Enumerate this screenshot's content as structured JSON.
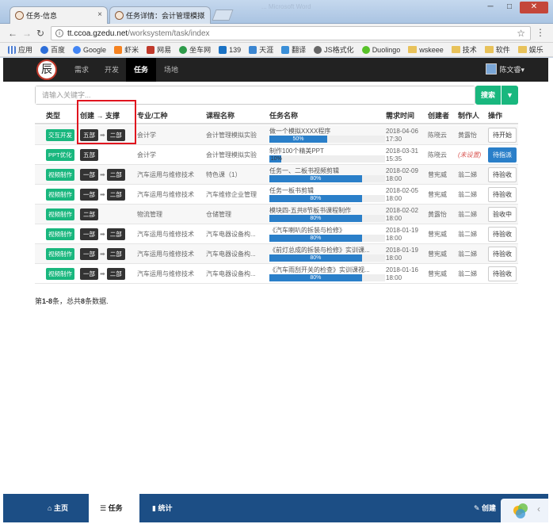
{
  "browser": {
    "tabs": [
      {
        "label": "任务-信息",
        "close": "×"
      },
      {
        "label": "任务详情：会计管理模拟",
        "close": "×"
      }
    ],
    "window_title": "... Microsoft Word",
    "controls": {
      "minimize": "─",
      "maximize": "□",
      "close": "✕"
    },
    "url_host": "tt.ccoa.gzedu.net",
    "url_path": "/worksystem/task/index",
    "bookmarks": [
      "应用",
      "百度",
      "Google",
      "虾米",
      "网易",
      "坐车网",
      "139",
      "天涯",
      "翻译",
      "JS格式化",
      "Duolingo",
      "wskeee",
      "技术",
      "软件",
      "娱乐"
    ]
  },
  "app": {
    "logo_char": "辰",
    "nav": [
      "需求",
      "开发",
      "任务",
      "场地"
    ],
    "active_nav": "任务",
    "user": "陈文睿▾",
    "search": {
      "placeholder": "请输入关键字...",
      "button": "搜索",
      "dropdown": "▼"
    }
  },
  "table": {
    "headers": [
      "类型",
      "创建 → 支撑",
      "专业/工种",
      "课程名称",
      "任务名称",
      "需求时间",
      "创建者",
      "制作人",
      "操作"
    ],
    "rows": [
      {
        "type": "交互开发",
        "dept_from": "五部",
        "dept_to": "二部",
        "major": "会计学",
        "course": "会计管理模拟实验",
        "task": "做一个模拟XXXX程序",
        "progress": 50,
        "progress_label": "50%",
        "date": "2018-04-06",
        "time": "17:30",
        "creator": "陈晓云",
        "maker": "黄露怡",
        "action": "待开始"
      },
      {
        "type": "PPT优化",
        "dept_from": "五部",
        "dept_to": "",
        "major": "会计学",
        "course": "会计管理模拟实验",
        "task": "制作100个精美PPT",
        "progress": 10,
        "progress_label": "10%",
        "date": "2018-03-31",
        "time": "15:35",
        "creator": "陈晓云",
        "maker": "(未设置)",
        "action": "待指派"
      },
      {
        "type": "视频制作",
        "dept_from": "一部",
        "dept_to": "二部",
        "major": "汽车运用与维修技术",
        "course": "特色课（1）",
        "task": "任务一、二板书视频剪辑",
        "progress": 80,
        "progress_label": "80%",
        "date": "2018-02-09",
        "time": "18:00",
        "creator": "曾宪威",
        "maker": "翁二娣",
        "action": "待验收"
      },
      {
        "type": "视频制作",
        "dept_from": "一部",
        "dept_to": "二部",
        "major": "汽车运用与维修技术",
        "course": "汽车维修企业管理",
        "task": "任务一板书剪辑",
        "progress": 80,
        "progress_label": "80%",
        "date": "2018-02-05",
        "time": "18:00",
        "creator": "曾宪威",
        "maker": "翁二娣",
        "action": "待验收"
      },
      {
        "type": "视频制作",
        "dept_from": "二部",
        "dept_to": "",
        "major": "物流管理",
        "course": "仓储管理",
        "task": "模块四-五共8节板书课程制作",
        "progress": 80,
        "progress_label": "80%",
        "date": "2018-02-02",
        "time": "18:00",
        "creator": "黄露怡",
        "maker": "翁二娣",
        "action": "验收中"
      },
      {
        "type": "视频制作",
        "dept_from": "一部",
        "dept_to": "二部",
        "major": "汽车运用与维修技术",
        "course": "汽车电器设备构...",
        "task": "《汽车喇叭的拆装与检修》",
        "progress": 80,
        "progress_label": "80%",
        "date": "2018-01-19",
        "time": "18:00",
        "creator": "曾宪威",
        "maker": "翁二娣",
        "action": "待验收"
      },
      {
        "type": "视频制作",
        "dept_from": "一部",
        "dept_to": "二部",
        "major": "汽车运用与维修技术",
        "course": "汽车电器设备构...",
        "task": "《前灯总成的拆装与检修》实训课...",
        "progress": 80,
        "progress_label": "80%",
        "date": "2018-01-19",
        "time": "18:00",
        "creator": "曾宪威",
        "maker": "翁二娣",
        "action": "待验收"
      },
      {
        "type": "视频制作",
        "dept_from": "一部",
        "dept_to": "二部",
        "major": "汽车运用与维修技术",
        "course": "汽车电器设备构...",
        "task": "《汽车雨刮开关的检查》实训课视...",
        "progress": 80,
        "progress_label": "80%",
        "date": "2018-01-16",
        "time": "18:00",
        "creator": "曾宪威",
        "maker": "翁二娣",
        "action": "待验收"
      }
    ],
    "arrow": "➡",
    "summary_prefix": "第",
    "summary_range": "1-8",
    "summary_mid": "条，总共",
    "summary_total": "8",
    "summary_suffix": "条数据."
  },
  "footer": {
    "home": "主页",
    "tasks": "任务",
    "stats": "统计",
    "create": "创建",
    "back": "‹"
  }
}
